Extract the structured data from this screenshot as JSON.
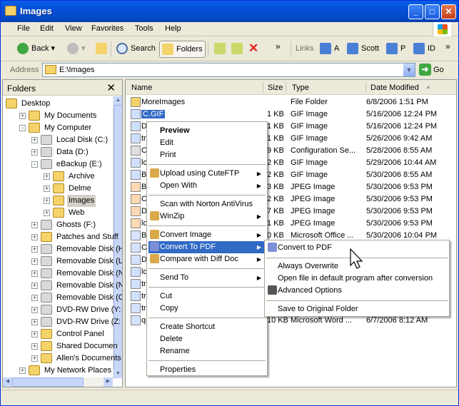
{
  "window": {
    "title": "Images"
  },
  "menubar": [
    "File",
    "Edit",
    "View",
    "Favorites",
    "Tools",
    "Help"
  ],
  "toolbar": {
    "back": "Back",
    "search": "Search",
    "folders": "Folders",
    "links_label": "Links",
    "links": [
      "A",
      "Scott",
      "P",
      "ID"
    ]
  },
  "address": {
    "label": "Address",
    "value": "E:\\Images",
    "go": "Go"
  },
  "folders_pane": {
    "title": "Folders",
    "close": "✕",
    "tree": [
      {
        "label": "Desktop",
        "depth": 0,
        "expander": ""
      },
      {
        "label": "My Documents",
        "depth": 1,
        "expander": "+"
      },
      {
        "label": "My Computer",
        "depth": 1,
        "expander": "−"
      },
      {
        "label": "Local Disk (C:)",
        "depth": 2,
        "expander": "+"
      },
      {
        "label": "Data (D:)",
        "depth": 2,
        "expander": "+"
      },
      {
        "label": "eBackup (E:)",
        "depth": 2,
        "expander": "−"
      },
      {
        "label": "Archive",
        "depth": 3,
        "expander": "+"
      },
      {
        "label": "Delme",
        "depth": 3,
        "expander": "+"
      },
      {
        "label": "Images",
        "depth": 3,
        "expander": "+",
        "selected": true
      },
      {
        "label": "Web",
        "depth": 3,
        "expander": "+"
      },
      {
        "label": "Ghosts (F:)",
        "depth": 2,
        "expander": "+"
      },
      {
        "label": "Patches and Stuff",
        "depth": 2,
        "expander": "+"
      },
      {
        "label": "Removable Disk (H",
        "depth": 2,
        "expander": "+"
      },
      {
        "label": "Removable Disk (L",
        "depth": 2,
        "expander": "+"
      },
      {
        "label": "Removable Disk (N",
        "depth": 2,
        "expander": "+"
      },
      {
        "label": "Removable Disk (N",
        "depth": 2,
        "expander": "+"
      },
      {
        "label": "Removable Disk (C",
        "depth": 2,
        "expander": "+"
      },
      {
        "label": "DVD-RW Drive (Y:",
        "depth": 2,
        "expander": "+"
      },
      {
        "label": "DVD-RW Drive (Z:",
        "depth": 2,
        "expander": "+"
      },
      {
        "label": "Control Panel",
        "depth": 2,
        "expander": "+"
      },
      {
        "label": "Shared Documen",
        "depth": 2,
        "expander": "+"
      },
      {
        "label": "Allen's Documents",
        "depth": 2,
        "expander": "+"
      },
      {
        "label": "My Network Places",
        "depth": 1,
        "expander": "+"
      }
    ]
  },
  "file_list": {
    "columns": [
      "Name",
      "Size",
      "Type",
      "Date Modified"
    ],
    "rows": [
      {
        "name": "MoreImages",
        "size": "",
        "type": "File Folder",
        "date": "6/8/2006 1:51 PM",
        "icon": "folder"
      },
      {
        "name": "C.GIF",
        "size": "1 KB",
        "type": "GIF Image",
        "date": "5/16/2006 12:24 PM",
        "icon": "gif",
        "selected": true
      },
      {
        "name": "D",
        "size": "1 KB",
        "type": "GIF Image",
        "date": "5/16/2006 12:24 PM",
        "icon": "gif"
      },
      {
        "name": "tr",
        "size": "1 KB",
        "type": "GIF Image",
        "date": "5/26/2006 9:42 AM",
        "icon": "gif"
      },
      {
        "name": "C",
        "size": "9 KB",
        "type": "Configuration Se...",
        "date": "5/28/2006 8:55 AM",
        "icon": "cfg"
      },
      {
        "name": "lo",
        "size": "2 KB",
        "type": "GIF Image",
        "date": "5/29/2006 10:44 AM",
        "icon": "gif"
      },
      {
        "name": "B",
        "size": "2 KB",
        "type": "GIF Image",
        "date": "5/30/2006 8:55 AM",
        "icon": "gif"
      },
      {
        "name": "B",
        "size": "3 KB",
        "type": "JPEG Image",
        "date": "5/30/2006 9:53 PM",
        "icon": "jpg"
      },
      {
        "name": "C",
        "size": "2 KB",
        "type": "JPEG Image",
        "date": "5/30/2006 9:53 PM",
        "icon": "jpg"
      },
      {
        "name": "D",
        "size": "7 KB",
        "type": "JPEG Image",
        "date": "5/30/2006 9:53 PM",
        "icon": "jpg"
      },
      {
        "name": "lo",
        "size": "1 KB",
        "type": "JPEG Image",
        "date": "5/30/2006 9:53 PM",
        "icon": "jpg"
      },
      {
        "name": "B",
        "size": "0 KB",
        "type": "Microsoft Office ...",
        "date": "5/30/2006 10:04 PM",
        "icon": "doc"
      },
      {
        "name": "C",
        "size": "",
        "type": "",
        "date": "",
        "icon": "doc"
      },
      {
        "name": "D",
        "size": "",
        "type": "",
        "date": "",
        "icon": "doc"
      },
      {
        "name": "lo",
        "size": "",
        "type": "",
        "date": "",
        "icon": "gif"
      },
      {
        "name": "tr",
        "size": "",
        "type": "",
        "date": "",
        "icon": "gif"
      },
      {
        "name": "tr",
        "size": "",
        "type": "",
        "date": "",
        "icon": "gif"
      },
      {
        "name": "tr",
        "size": "",
        "type": "",
        "date": "",
        "icon": "doc"
      },
      {
        "name": "qu",
        "size": "10 KB",
        "type": "Microsoft Word ...",
        "date": "6/7/2006 8:12 AM",
        "icon": "doc"
      }
    ]
  },
  "context_menu": {
    "items": [
      {
        "label": "Preview",
        "bold": true
      },
      {
        "label": "Edit"
      },
      {
        "label": "Print"
      },
      {
        "separator": true
      },
      {
        "label": "Upload using CuteFTP",
        "submenu": true,
        "icon": "cuteftp-icon"
      },
      {
        "label": "Open With",
        "submenu": true
      },
      {
        "separator": true
      },
      {
        "label": "Scan with Norton AntiVirus"
      },
      {
        "label": "WinZip",
        "submenu": true,
        "icon": "winzip-icon"
      },
      {
        "separator": true
      },
      {
        "label": "Convert Image",
        "submenu": true,
        "icon": "convert-image-icon"
      },
      {
        "label": "Convert To PDF",
        "submenu": true,
        "icon": "pdf-icon",
        "highlighted": true
      },
      {
        "label": "Compare with Diff Doc",
        "submenu": true,
        "icon": "diff-icon"
      },
      {
        "separator": true
      },
      {
        "label": "Send To",
        "submenu": true
      },
      {
        "separator": true
      },
      {
        "label": "Cut"
      },
      {
        "label": "Copy"
      },
      {
        "separator": true
      },
      {
        "label": "Create Shortcut"
      },
      {
        "label": "Delete"
      },
      {
        "label": "Rename"
      },
      {
        "separator": true
      },
      {
        "label": "Properties"
      }
    ]
  },
  "submenu": {
    "items": [
      {
        "label": "Convert to PDF",
        "icon": "pdf-icon"
      },
      {
        "separator": true
      },
      {
        "label": "Always Overwrite"
      },
      {
        "label": "Open file in default program after conversion"
      },
      {
        "label": "Advanced Options",
        "icon": "tools-icon"
      },
      {
        "separator": true
      },
      {
        "label": "Save to Original Folder"
      }
    ]
  }
}
